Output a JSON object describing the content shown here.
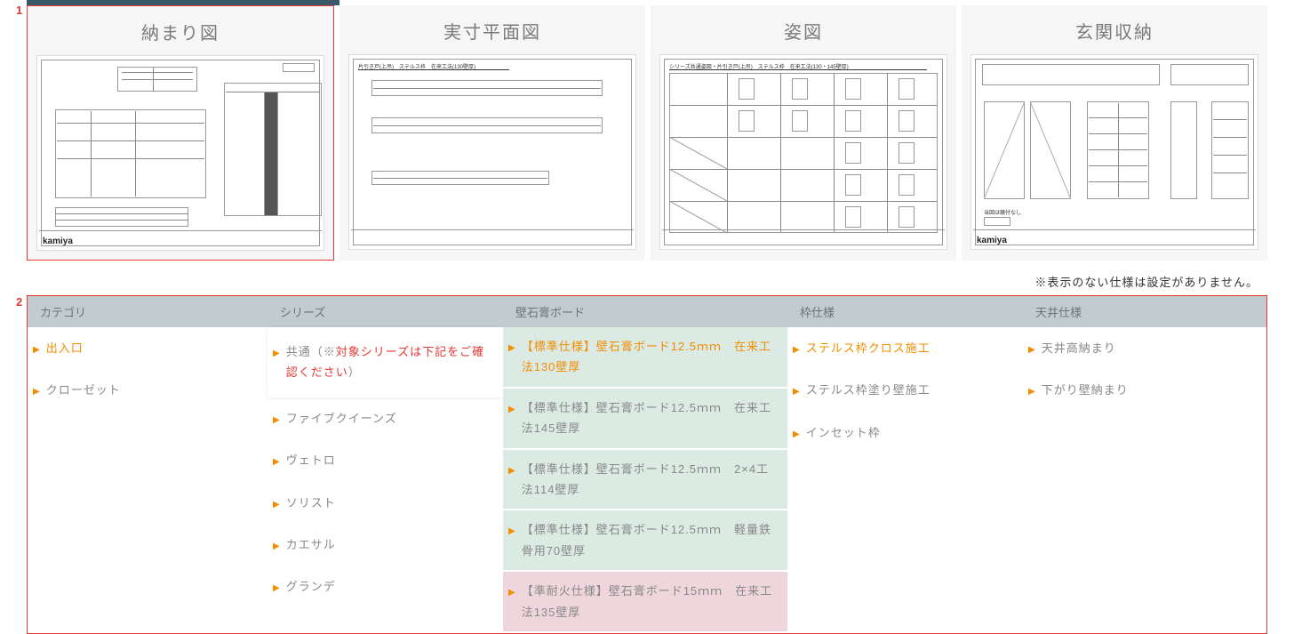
{
  "tabs": [
    {
      "label": "納まり図"
    },
    {
      "label": "実寸平面図"
    },
    {
      "label": "姿図"
    },
    {
      "label": "玄関収納"
    }
  ],
  "note": "※表示のない仕様は設定がありません。",
  "callouts": {
    "c1": "1",
    "c2": "2"
  },
  "filter": {
    "headers": {
      "category": "カテゴリ",
      "series": "シリーズ",
      "board": "壁石膏ボード",
      "frame": "枠仕様",
      "ceiling": "天井仕様"
    },
    "category": [
      {
        "label": "出入口",
        "selected": true
      },
      {
        "label": "クローゼット"
      }
    ],
    "series": [
      {
        "label_pre": "共通（※",
        "label_red": "対象シリーズは下記をご確認ください",
        "label_post": "）",
        "special": true
      },
      {
        "label": "ファイブクイーンズ"
      },
      {
        "label": "ヴェトロ"
      },
      {
        "label": "ソリスト"
      },
      {
        "label": "カエサル"
      },
      {
        "label": "グランデ"
      }
    ],
    "board": [
      {
        "label": "【標準仕様】壁石膏ボード12.5ｍｍ　在来工法130壁厚",
        "selected": true
      },
      {
        "label": "【標準仕様】壁石膏ボード12.5ｍｍ　在来工法145壁厚"
      },
      {
        "label": "【標準仕様】壁石膏ボード12.5ｍｍ　2×4工法114壁厚"
      },
      {
        "label": "【標準仕様】壁石膏ボード12.5ｍｍ　軽量鉄骨用70壁厚"
      },
      {
        "label": "【準耐火仕様】壁石膏ボード15ｍｍ　在来工法135壁厚",
        "pink": true
      }
    ],
    "frame": [
      {
        "label": "ステルス枠クロス施工",
        "selected": true
      },
      {
        "label": "ステルス枠塗り壁施工"
      },
      {
        "label": "インセット枠"
      }
    ],
    "ceiling": [
      {
        "label": "天井高納まり"
      },
      {
        "label": "下がり壁納まり"
      }
    ]
  },
  "thumb_labels": {
    "t1": "片引き戸(上吊)　ステルス枠　在来工法(130壁厚)",
    "t2": "シリーズ共通姿図・片引き戸(上吊)　ステルス枠　在来工法(130・145壁厚)",
    "t3_note": "当図は鏡付なし",
    "kamiya": "kamiya"
  }
}
